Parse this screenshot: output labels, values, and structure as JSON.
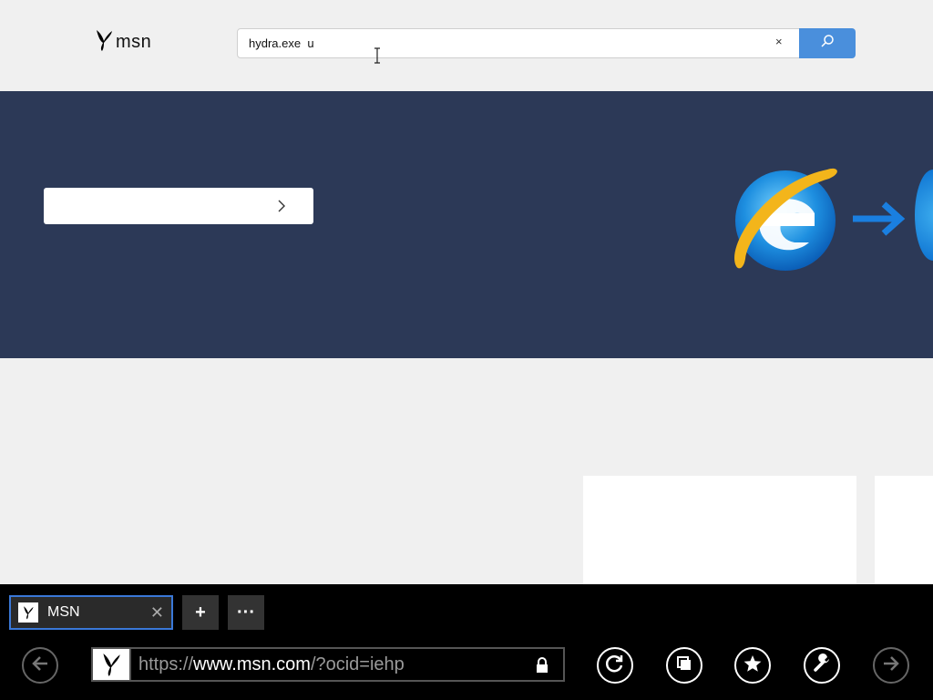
{
  "header": {
    "logo_text": "msn",
    "search": {
      "value": "hydra.exe  u",
      "clear_label": "×"
    }
  },
  "tabs": [
    {
      "title": "MSN",
      "close_label": "✕"
    }
  ],
  "tab_actions": {
    "new_tab_label": "+",
    "more_label": "···"
  },
  "address_bar": {
    "scheme": "https://",
    "host": "www.msn.com",
    "path": "/?ocid=iehp"
  },
  "colors": {
    "banner": "#2c3957",
    "search_button": "#4a8fdc",
    "tab_border": "#3a78d8"
  },
  "icons": [
    "msn-butterfly-icon",
    "search-icon",
    "chevron-right-icon",
    "ie-logo-icon",
    "arrow-right-icon",
    "back-icon",
    "refresh-icon",
    "tabs-icon",
    "favorites-icon",
    "tools-icon",
    "forward-icon",
    "lock-icon"
  ]
}
